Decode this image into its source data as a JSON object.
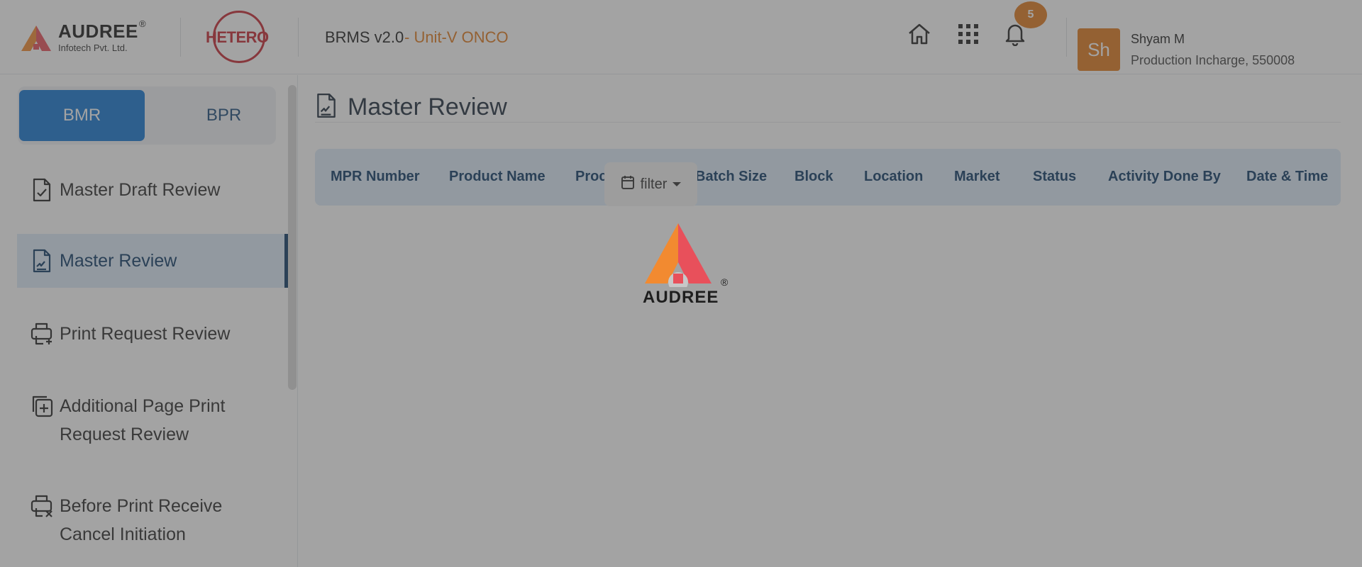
{
  "header": {
    "brand_name": "AUDREE",
    "brand_reg": "®",
    "brand_sub": "Infotech Pvt. Ltd.",
    "partner_name": "HETERO",
    "app_title": "BRMS v2.0",
    "app_unit": "- Unit-V ONCO",
    "icons": [
      "home-icon",
      "apps-grid-icon",
      "bell-icon"
    ],
    "notification_count": "5",
    "user": {
      "initials": "Sh",
      "name": "Shyam M",
      "role": "Production Incharge, 550008"
    }
  },
  "sidebar": {
    "toggle": {
      "active": "BMR",
      "inactive": "BPR"
    },
    "items": [
      {
        "label": "Master Draft Review",
        "icon": "document-check-icon",
        "active": false
      },
      {
        "label": "Master Review",
        "icon": "document-signature-icon",
        "active": true
      },
      {
        "label": "Print Request Review",
        "icon": "printer-add-icon",
        "active": false
      },
      {
        "label_line1": "Additional Page Print",
        "label_line2": "Request Review",
        "icon": "copy-add-icon",
        "active": false
      },
      {
        "label_line1": "Before Print Receive",
        "label_line2": "Cancel Initiation",
        "icon": "printer-cancel-icon",
        "active": false
      }
    ]
  },
  "main": {
    "page_title": "Master Review",
    "table": {
      "columns": [
        "MPR Number",
        "Product Name",
        "Proc",
        "Batch Size",
        "Block",
        "Location",
        "Market",
        "Status",
        "Activity Done By",
        "Date & Time"
      ]
    },
    "filter_label": "filter"
  },
  "loader": {
    "word": "AUDREE",
    "reg": "®"
  },
  "colors": {
    "brand_blue": "#1577d2",
    "nav_dark": "#0f3a66",
    "accent_orange": "#e07a1f",
    "hetero_red": "#c62832",
    "overlay": "rgba(72,72,72,0.5)"
  }
}
